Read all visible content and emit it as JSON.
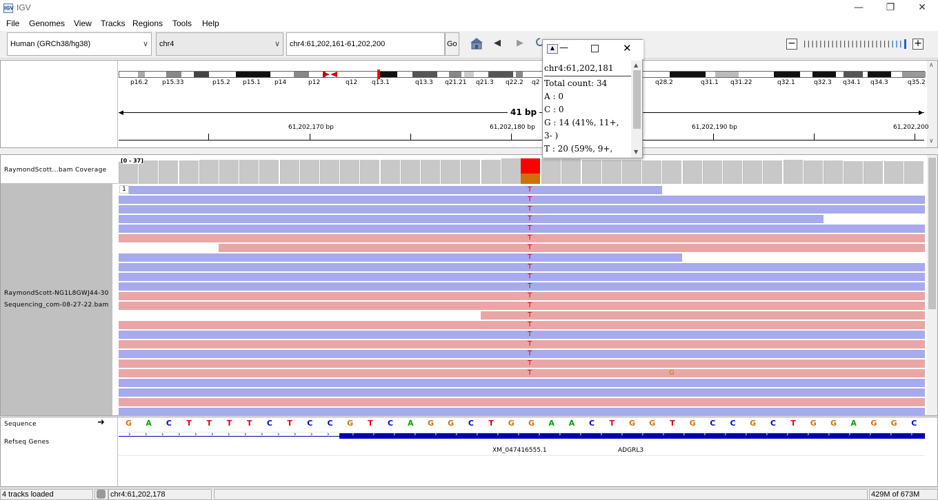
{
  "window": {
    "title": "IGV",
    "app_icon": "IGV"
  },
  "menu": [
    "File",
    "Genomes",
    "View",
    "Tracks",
    "Regions",
    "Tools",
    "Help"
  ],
  "toolbar": {
    "genome": "Human (GRCh38/hg38)",
    "chromosome": "chr4",
    "locus": "chr4:61,202,161-61,202,200",
    "go_label": "Go"
  },
  "ideogram": {
    "bands": [
      "p16.2",
      "p15.33",
      "p15.2",
      "p15.1",
      "p14",
      "p12",
      "q12",
      "q13.1",
      "q13.3",
      "q21.21",
      "q21.3",
      "q22.2",
      "q2",
      "q28.2",
      "q31.1",
      "q31.22",
      "q32.1",
      "q32.3",
      "q34.1",
      "q34.3",
      "q35.2"
    ]
  },
  "ruler": {
    "span": "41 bp",
    "ticks": [
      "61,202,170 bp",
      "61,202,180 bp",
      "61,202,190 bp",
      "61,202,200"
    ]
  },
  "tracks": {
    "coverage_name": "RaymondScott...bam Coverage",
    "coverage_range": "[0 - 37]",
    "alignment_name_1": "RaymondScott-NG1L8GWJ44-30",
    "alignment_name_2": "Sequencing_com-08-27-22.bam",
    "alignment_label": "1",
    "sequence_name": "Sequence",
    "genes_name": "Refseq Genes",
    "sequence": [
      "G",
      "A",
      "C",
      "T",
      "T",
      "T",
      "T",
      "C",
      "T",
      "C",
      "C",
      "G",
      "T",
      "C",
      "A",
      "G",
      "G",
      "C",
      "T",
      "G",
      "G",
      "A",
      "A",
      "C",
      "T",
      "G",
      "G",
      "T",
      "G",
      "C",
      "C",
      "G",
      "C",
      "T",
      "G",
      "G",
      "A",
      "G",
      "G",
      "C"
    ],
    "gene_labels": [
      "XM_047416555.1",
      "ADGRL3"
    ],
    "mismatch_base": "T",
    "mismatch_base_2": "G"
  },
  "popup": {
    "title": "chr4:61,202,181",
    "lines": [
      "Total count: 34",
      "A : 0",
      "C : 0",
      "G : 14 (41%, 11+,",
      "3- )",
      "T : 20 (59%, 9+,"
    ]
  },
  "status": {
    "tracks_loaded": "4 tracks loaded",
    "position": "chr4:61,202,178",
    "memory": "429M of 673M"
  },
  "colors": {
    "base_A": "#00a000",
    "base_C": "#0000c8",
    "base_G": "#d17105",
    "base_T": "#e00000",
    "read_forward": "#a8aaee",
    "read_reverse": "#eaa6a6",
    "gene": "#0000b2"
  }
}
